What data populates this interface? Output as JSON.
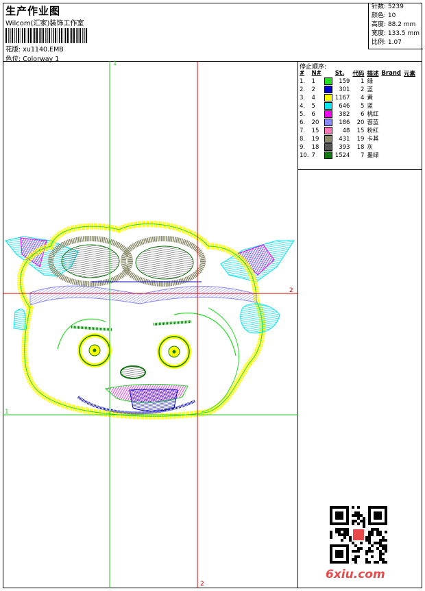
{
  "header": {
    "title": "生产作业图",
    "subtitle": "Wilcom(汇家)装饰工作室",
    "pattern_label": "花版: xu1140.EMB",
    "colorway_label": "色位: Colorway 1"
  },
  "stats": {
    "stitches": "针数: 5239",
    "colors": "颜色: 10",
    "height": "高度: 88.2 mm",
    "width": "宽度: 133.5 mm",
    "ratio": "比例: 1.07"
  },
  "sequence": {
    "title": "停止顺序:",
    "headers": [
      "#",
      "N#",
      "St.",
      "代码",
      "描述",
      "Brand",
      "元素"
    ],
    "rows": [
      {
        "idx": "1.",
        "n": "1",
        "color": "#22dd22",
        "st": "159",
        "code": "1",
        "desc": "绿"
      },
      {
        "idx": "2.",
        "n": "2",
        "color": "#0000cc",
        "st": "301",
        "code": "2",
        "desc": "蓝"
      },
      {
        "idx": "3.",
        "n": "4",
        "color": "#ffff00",
        "st": "1167",
        "code": "4",
        "desc": "黄"
      },
      {
        "idx": "4.",
        "n": "5",
        "color": "#00e5ee",
        "st": "646",
        "code": "5",
        "desc": "蓝"
      },
      {
        "idx": "5.",
        "n": "6",
        "color": "#ee00ee",
        "st": "382",
        "code": "6",
        "desc": "桃红"
      },
      {
        "idx": "6.",
        "n": "20",
        "color": "#8888ff",
        "st": "186",
        "code": "20",
        "desc": "蓉蓝"
      },
      {
        "idx": "7.",
        "n": "15",
        "color": "#ff77bb",
        "st": "48",
        "code": "15",
        "desc": "粉红"
      },
      {
        "idx": "8.",
        "n": "19",
        "color": "#8b8a6a",
        "st": "431",
        "code": "19",
        "desc": "卡其"
      },
      {
        "idx": "9.",
        "n": "18",
        "color": "#555555",
        "st": "393",
        "code": "18",
        "desc": "灰"
      },
      {
        "idx": "10.",
        "n": "7",
        "color": "#117711",
        "st": "1524",
        "code": "7",
        "desc": "墨绿"
      }
    ]
  },
  "guides": {
    "v1": "1",
    "v2": "2",
    "h1": "1",
    "h2": "2"
  },
  "watermark": "6xiu.com",
  "colors": {
    "green_guide": "#22cc22",
    "red_guide": "#dd0000",
    "watermark": "#e8494a"
  }
}
